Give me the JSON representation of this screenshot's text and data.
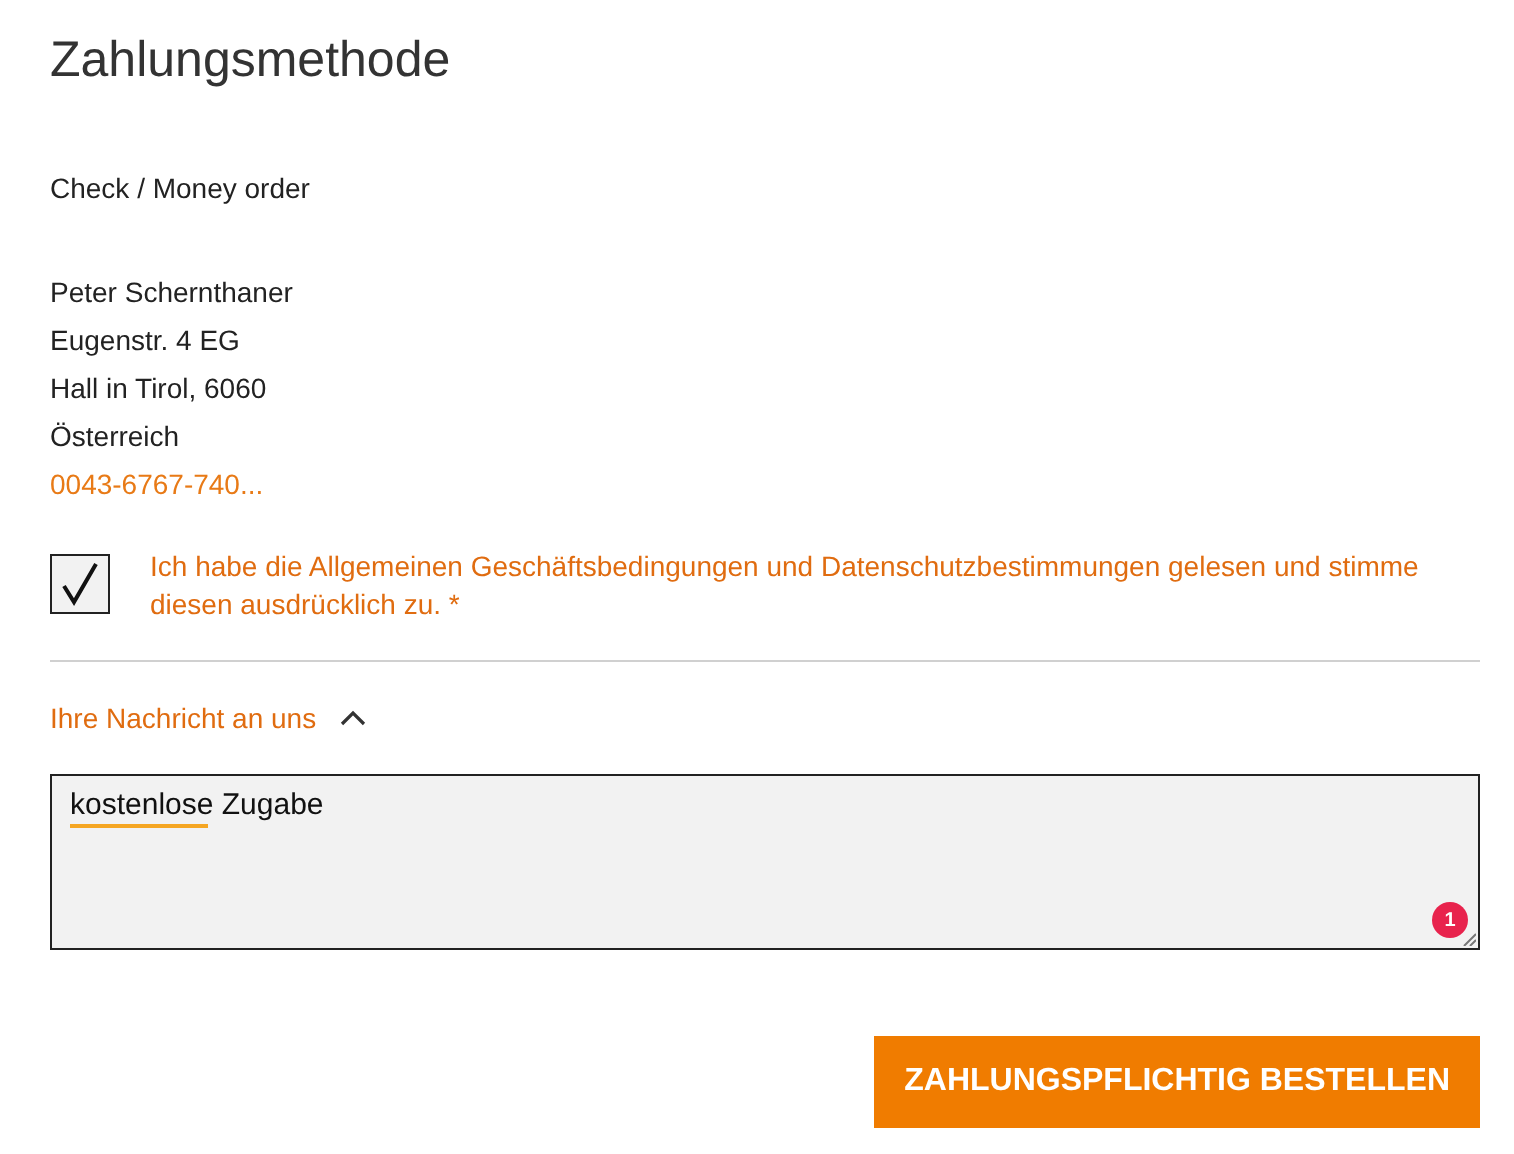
{
  "title": "Zahlungsmethode",
  "payment_method": "Check / Money order",
  "address": [
    "Peter Schernthaner",
    "Eugenstr. 4 EG",
    "Hall in Tirol, 6060",
    "Österreich"
  ],
  "phone": "0043-6767-740...",
  "terms": {
    "checked": true,
    "label": "Ich habe die Allgemeinen Geschäftsbedingungen und Datenschutzbestimmungen gelesen und stimme diesen ausdrücklich zu. *"
  },
  "message": {
    "label": "Ihre Nachricht an uns",
    "expanded": true,
    "value": "kostenlose Zugabe",
    "issues_badge": "1"
  },
  "submit_button": "ZAHLUNGSPFLICHTIG BESTELLEN"
}
